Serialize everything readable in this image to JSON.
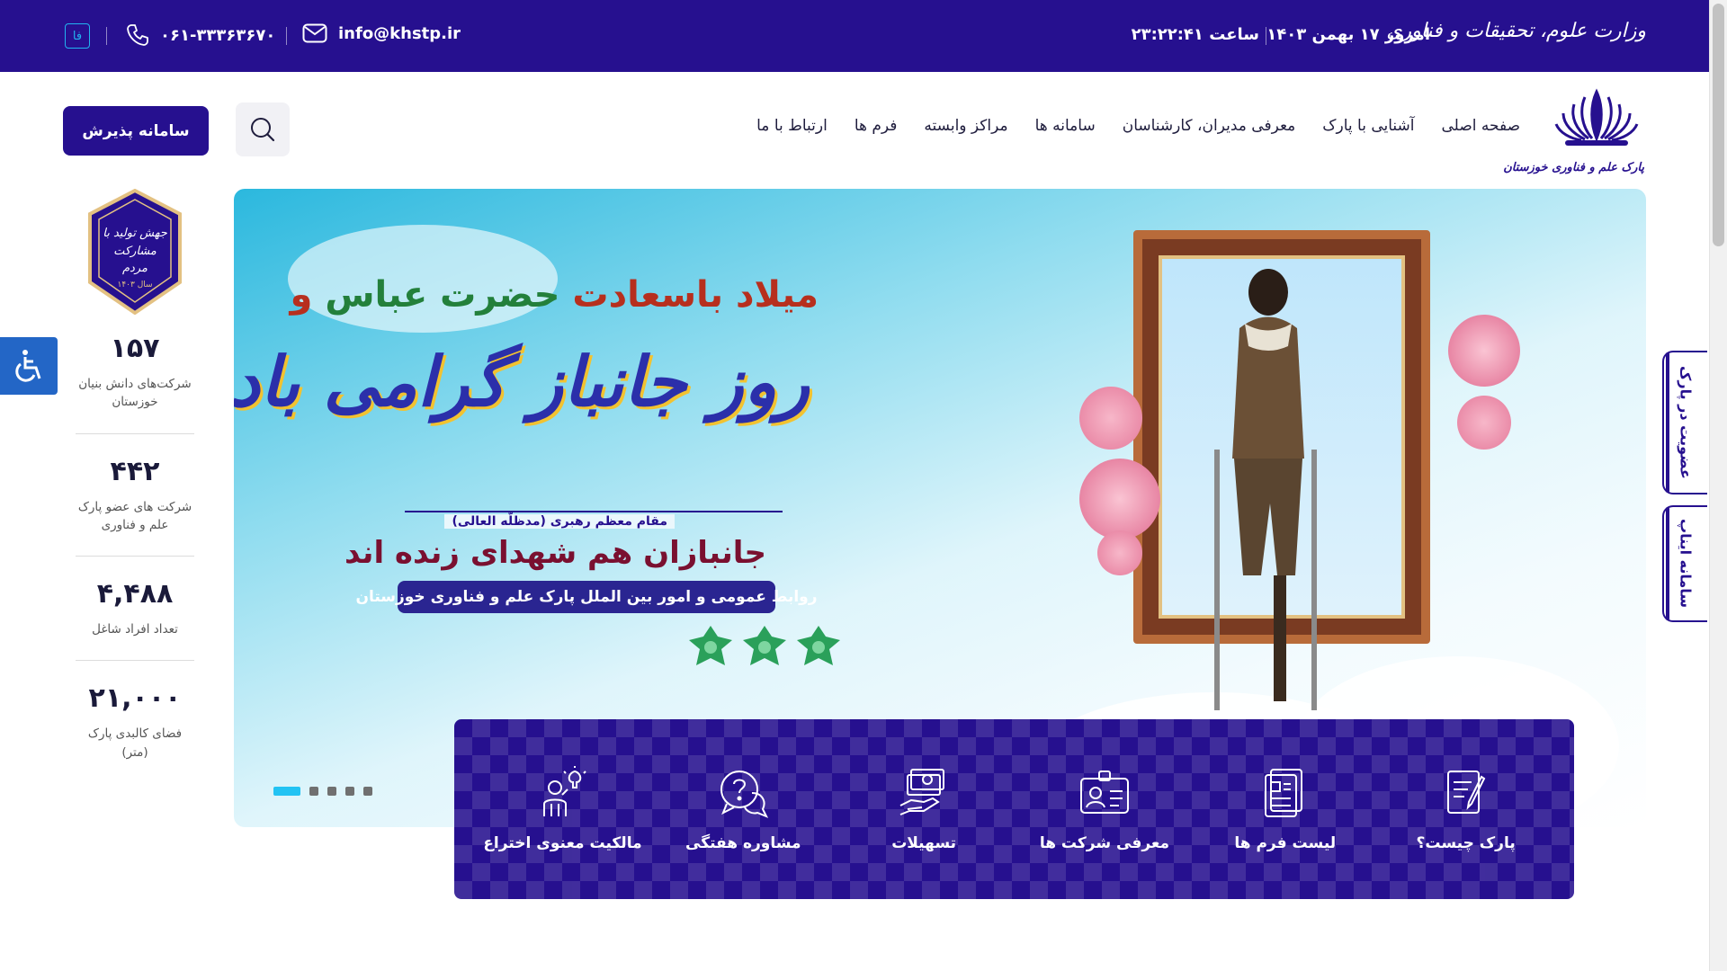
{
  "topbar": {
    "ministry": "وزارت علوم، تحقیقات و فناوری",
    "date": "امروز ۱۷ بهمن ۱۴۰۳",
    "time": "ساعت ۲۳:۲۲:۴۱",
    "email": "info@khstp.ir",
    "phone": "۰۶۱-۳۳۳۶۳۶۷۰",
    "lang": "فا",
    "bg_color": "#26108f"
  },
  "nav": {
    "logo_text": "پارک علم و فناوری خوزستان",
    "items": [
      "صفحه اصلی",
      "آشنایی با پارک",
      "معرفی مدیران، کارشناسان",
      "سامانه ها",
      "مراکز وابسته",
      "فرم ها",
      "ارتباط با ما"
    ],
    "register_label": "سامانه پذیرش",
    "search_icon": "search-icon"
  },
  "hero": {
    "title_red": "میلاد باسعادت ",
    "title_green": "حضرت عباس",
    "title_red_end": " و",
    "title_main": "روز جانباز گرامی باد",
    "leader": "مقام معظم رهبری (مدظلّه العالی)",
    "quote": "جانبازان هم شهدای زنده اند",
    "public_relations": "روابط عمومی و امور بین الملل پارک علم و فناوری خوزستان",
    "slides_count": 5,
    "active_slide": 1
  },
  "quick_access": [
    {
      "label": "پارک چیست؟",
      "icon": "document-pen-icon"
    },
    {
      "label": "لیست فرم ها",
      "icon": "form-list-icon"
    },
    {
      "label": "معرفی شرکت ها",
      "icon": "id-card-icon"
    },
    {
      "label": "تسهیلات",
      "icon": "money-hand-icon"
    },
    {
      "label": "مشاوره هفتگی",
      "icon": "question-chat-icon"
    },
    {
      "label": "مالکیت معنوی اختراع",
      "icon": "idea-person-icon"
    }
  ],
  "badge": {
    "text": "جهش تولید با مشارکت مردم",
    "year": "سال ۱۴۰۳"
  },
  "stats": [
    {
      "value": "۱۵۷",
      "label": "شرکت‌های دانش بنیان خوزستان"
    },
    {
      "value": "۴۴۲",
      "label": "شرکت های عضو پارک علم و فناوری"
    },
    {
      "value": "۴,۴۸۸",
      "label": "تعداد افراد شاغل"
    },
    {
      "value": "۲۱,۰۰۰",
      "label": "فضای کالبدی پارک (متر)"
    }
  ],
  "side_tabs": [
    {
      "label": "عضویت در پارک"
    },
    {
      "label": "سامانه ایناپ"
    }
  ],
  "accessibility_icon": "wheelchair-icon"
}
